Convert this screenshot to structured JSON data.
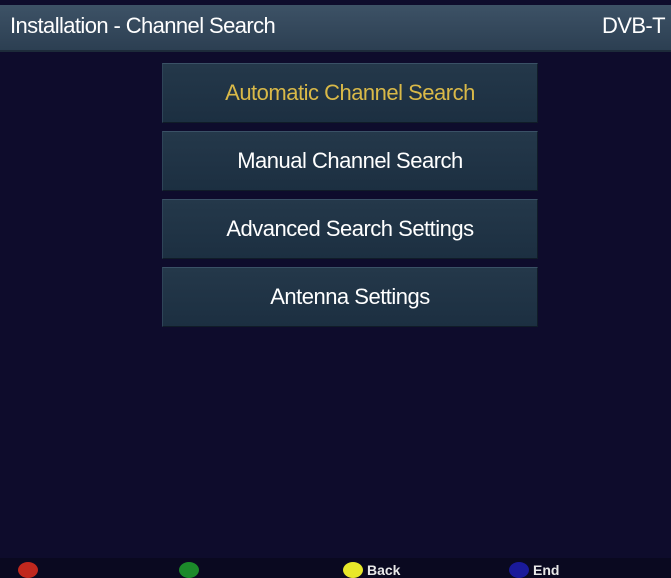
{
  "header": {
    "title": "Installation - Channel Search",
    "mode": "DVB-T"
  },
  "menu": {
    "items": [
      {
        "label": "Automatic Channel Search",
        "selected": true
      },
      {
        "label": "Manual Channel Search",
        "selected": false
      },
      {
        "label": "Advanced Search Settings",
        "selected": false
      },
      {
        "label": "Antenna Settings",
        "selected": false
      }
    ]
  },
  "footer": {
    "keys": [
      {
        "color_name": "red",
        "color": "#c0281e",
        "label": ""
      },
      {
        "color_name": "green",
        "color": "#1c8a2a",
        "label": ""
      },
      {
        "color_name": "yellow",
        "color": "#e8e82a",
        "label": "Back"
      },
      {
        "color_name": "blue",
        "color": "#1a1a9a",
        "label": "End"
      }
    ]
  },
  "colors": {
    "background": "#0e0c2c",
    "header": "#34495c",
    "selected_text": "#d9b948",
    "menu_item": "#203446"
  }
}
